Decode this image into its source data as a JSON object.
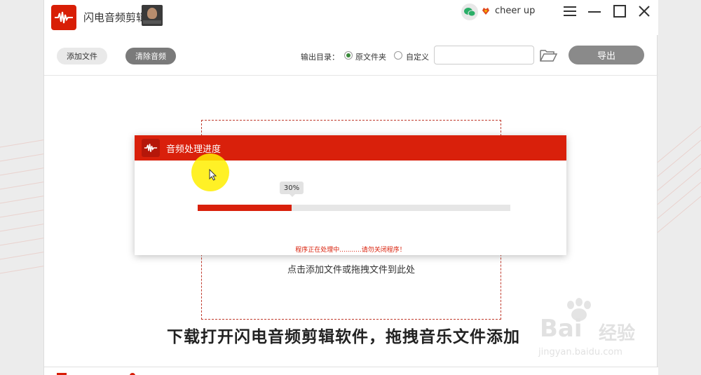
{
  "app": {
    "title": "闪电音频剪辑",
    "user_name": "cheer up"
  },
  "toolbar": {
    "add_file_label": "添加文件",
    "clear_audio_label": "清除音频",
    "output_dir_label": "输出目录：",
    "option_source_folder": "原文件夹",
    "option_custom": "自定义",
    "path_value": "",
    "export_label": "导出"
  },
  "dropzone": {
    "hint": "点击添加文件或拖拽文件到此处"
  },
  "dialog": {
    "title": "音频处理进度",
    "percent_label": "30%",
    "progress": 0.3,
    "status": "程序正在处理中...........请勿关闭程序！"
  },
  "caption": "下载打开闪电音频剪辑软件，拖拽音乐文件添加",
  "watermark": {
    "brand": "Bai",
    "brand_tail": "经验",
    "url": "jingyan.baidu.com"
  },
  "colors": {
    "accent": "#d9200b",
    "highlight": "#ffee00"
  },
  "icons": {
    "app": "waveform-icon",
    "wechat": "wechat-icon",
    "vip": "vip-heart-icon",
    "menu": "menu-icon",
    "minimize": "minimize-icon",
    "maximize": "maximize-icon",
    "close": "close-icon",
    "folder": "folder-open-icon",
    "cursor": "mouse-cursor-icon"
  }
}
